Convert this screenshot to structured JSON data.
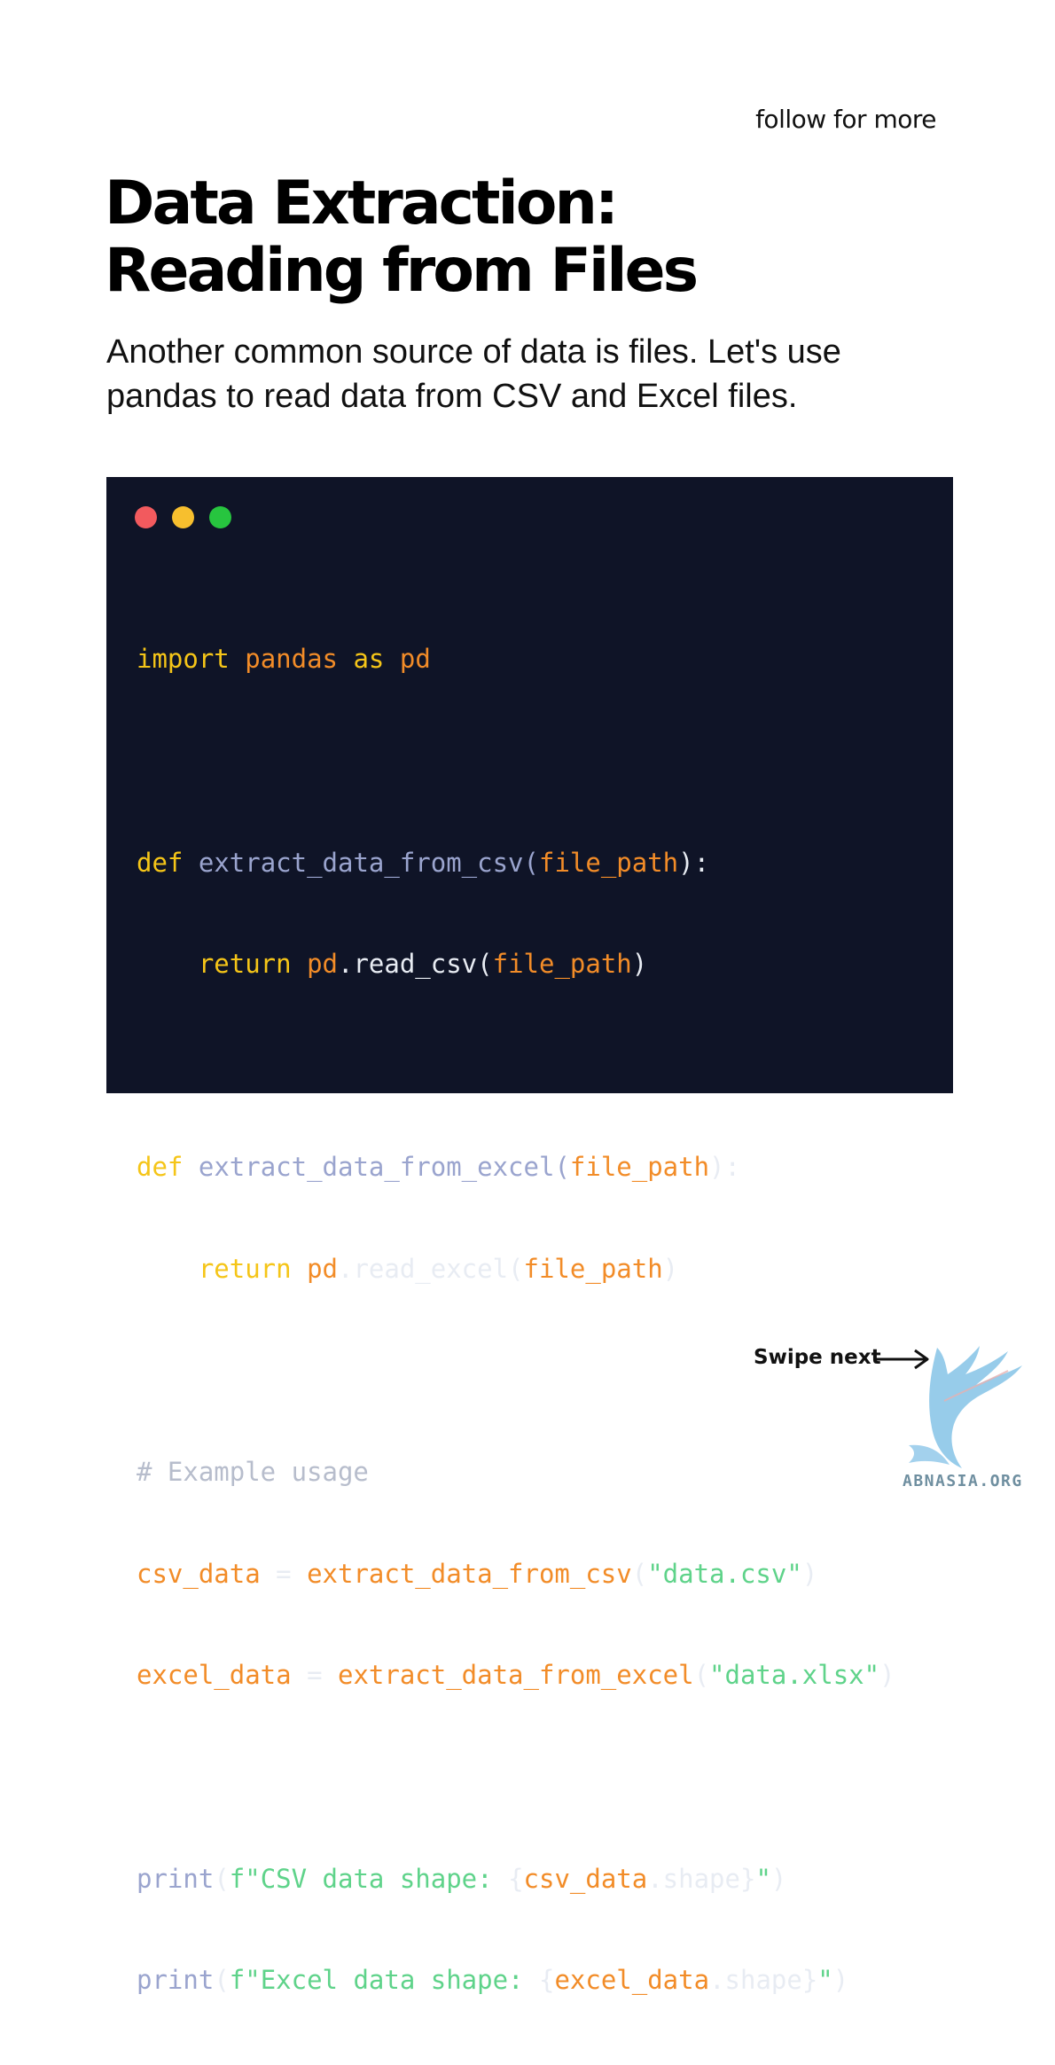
{
  "header": {
    "follow_text": "follow for more"
  },
  "title": {
    "line1": "Data Extraction:",
    "line2": "Reading from Files"
  },
  "intro": {
    "line1": "Another common source of data is files. Let's use",
    "line2": "pandas to read data from CSV and Excel files."
  },
  "code_window": {
    "controls": [
      "red",
      "yellow",
      "green"
    ],
    "lines": {
      "l1": {
        "t1": "import",
        "t2": "pandas",
        "t3": "as",
        "t4": "pd"
      },
      "l3": {
        "t1": "def",
        "t2": "extract_data_from_csv",
        "t3": "(",
        "t4": "file_path",
        "t5": "):"
      },
      "l4": {
        "t1": "return",
        "t2": "pd",
        "t3": ".read_csv(",
        "t4": "file_path",
        "t5": ")"
      },
      "l6": {
        "t1": "def",
        "t2": "extract_data_from_excel",
        "t3": "(",
        "t4": "file_path",
        "t5": "):"
      },
      "l7": {
        "t1": "return",
        "t2": "pd",
        "t3": ".read_excel(",
        "t4": "file_path",
        "t5": ")"
      },
      "l9": {
        "t1": "# Example usage"
      },
      "l10": {
        "t1": "csv_data",
        "t2": " = ",
        "t3": "extract_data_from_csv",
        "t4": "(",
        "t5": "\"data.csv\"",
        "t6": ")"
      },
      "l11": {
        "t1": "excel_data",
        "t2": " = ",
        "t3": "extract_data_from_excel",
        "t4": "(",
        "t5": "\"data.xlsx\"",
        "t6": ")"
      },
      "l13": {
        "t1": "print",
        "t2": "(",
        "t3": "f\"CSV data shape: ",
        "t4": "{",
        "t5": "csv_data",
        "t6": ".shape}",
        "t7": "\"",
        "t8": ")"
      },
      "l14": {
        "t1": "print",
        "t2": "(",
        "t3": "f\"Excel data shape: ",
        "t4": "{",
        "t5": "excel_data",
        "t6": ".shape}",
        "t7": "\"",
        "t8": ")"
      }
    }
  },
  "footer": {
    "swipe_label": "Swipe next",
    "arrow_icon": "arrow-right-icon",
    "logo_icon": "griffin-logo-icon",
    "logo_text": "ABNASIA.ORG"
  },
  "colors": {
    "code_background": "#0f1427",
    "keyword": "#f5c518",
    "variable": "#f28c28",
    "function": "#9aa4ce",
    "string": "#5fd38a",
    "comment": "#b7bdcc"
  }
}
